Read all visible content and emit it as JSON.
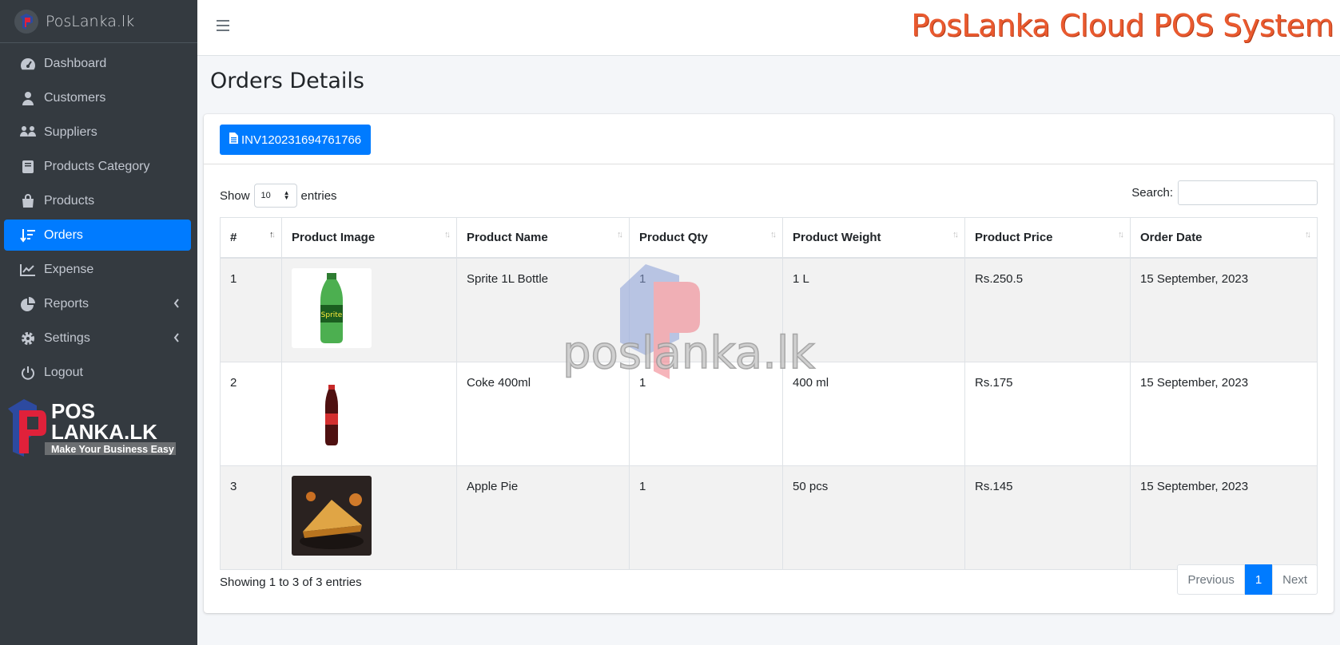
{
  "brand": {
    "name": "PosLanka.lk"
  },
  "sidebar": {
    "items": [
      {
        "label": "Dashboard",
        "icon": "dashboard-gauge-icon",
        "active": false
      },
      {
        "label": "Customers",
        "icon": "user-icon",
        "active": false
      },
      {
        "label": "Suppliers",
        "icon": "people-icon",
        "active": false
      },
      {
        "label": "Products Category",
        "icon": "book-icon",
        "active": false
      },
      {
        "label": "Products",
        "icon": "shopping-bag-icon",
        "active": false
      },
      {
        "label": "Orders",
        "icon": "sort-list-icon",
        "active": true
      },
      {
        "label": "Expense",
        "icon": "line-chart-icon",
        "active": false
      },
      {
        "label": "Reports",
        "icon": "pie-chart-icon",
        "active": false,
        "caret": true
      },
      {
        "label": "Settings",
        "icon": "gear-icon",
        "active": false,
        "caret": true
      },
      {
        "label": "Logout",
        "icon": "power-icon",
        "active": false
      }
    ],
    "logo": {
      "line1": "POS",
      "line2": "LANKA.LK",
      "tagline": "Make Your Business Easy"
    }
  },
  "header": {
    "system_title": "PosLanka Cloud POS System"
  },
  "page": {
    "title": "Orders Details"
  },
  "invoice_button": {
    "label": "INV120231694761766"
  },
  "table_controls": {
    "show_label": "Show",
    "entries_label": "entries",
    "page_length": "10",
    "search_label": "Search:",
    "search_value": ""
  },
  "table": {
    "columns": [
      "#",
      "Product Image",
      "Product Name",
      "Product Qty",
      "Product Weight",
      "Product Price",
      "Order Date"
    ],
    "rows": [
      {
        "no": "1",
        "image": "sprite-bottle-image",
        "name": "Sprite 1L Bottle",
        "qty": "1",
        "weight": "1 L",
        "price": "Rs.250.5",
        "date": "15 September, 2023"
      },
      {
        "no": "2",
        "image": "coke-bottle-image",
        "name": "Coke 400ml",
        "qty": "1",
        "weight": "400 ml",
        "price": "Rs.175",
        "date": "15 September, 2023"
      },
      {
        "no": "3",
        "image": "apple-pie-image",
        "name": "Apple Pie",
        "qty": "1",
        "weight": "50 pcs",
        "price": "Rs.145",
        "date": "15 September, 2023"
      }
    ]
  },
  "watermark": {
    "text": "poslanka.lk"
  },
  "footer": {
    "info": "Showing 1 to 3 of 3 entries",
    "prev": "Previous",
    "current": "1",
    "next": "Next"
  },
  "colors": {
    "accent": "#007bff",
    "sidebar_bg": "#343a40",
    "title_orange": "#ea5a2f"
  }
}
